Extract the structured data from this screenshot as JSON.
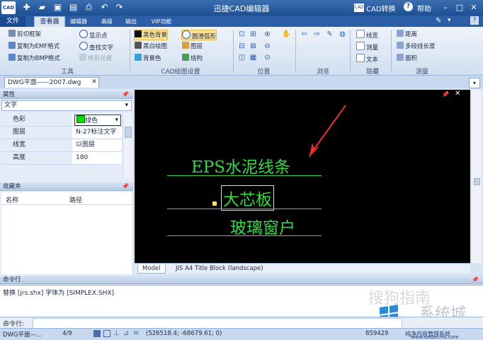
{
  "app": {
    "title": "迅捷CAD编辑器",
    "logo": "CAD",
    "convert_label": "CAD转换",
    "help_label": "帮助"
  },
  "tabs": [
    "文件",
    "查看器",
    "编辑器",
    "高级",
    "输出",
    "VIP功能"
  ],
  "ribbon": {
    "tools": {
      "items": [
        "剪切框架",
        "复制为EMF格式",
        "复制为BMP格式",
        "显示点",
        "查找文字",
        "修剪光栅"
      ],
      "label": "工具"
    },
    "draw": {
      "items": [
        "黑色背景",
        "黑白绘图",
        "背景色",
        "圆滑弧形",
        "图层",
        "结构"
      ],
      "label": "CAD绘图设置"
    },
    "position": {
      "label": "位置"
    },
    "browse": {
      "label": "浏览"
    },
    "hide": {
      "items": [
        "线宽",
        "测量",
        "文本"
      ],
      "label": "隐藏"
    },
    "measure": {
      "items": [
        "距离",
        "多段线长度",
        "面积"
      ],
      "label": "测量"
    }
  },
  "document_tab": "DWG平面——2007.dwg",
  "properties": {
    "title": "属性",
    "dropdown": "文字",
    "rows": [
      {
        "key": "色彩",
        "value": "绿色"
      },
      {
        "key": "图层",
        "value": "N-27标注文字"
      },
      {
        "key": "线宽",
        "value": "以图层"
      },
      {
        "key": "高度",
        "value": "180"
      }
    ],
    "color_swatch": "#00e000"
  },
  "favorites": {
    "title": "收藏夹",
    "columns": [
      "名称",
      "路径"
    ]
  },
  "canvas": {
    "texts": [
      "EPS水泥线条",
      "大芯板",
      "玻璃窗户"
    ],
    "line_color": "#38d846",
    "arrow_color": "#e83030",
    "layout_tabs": [
      "Model",
      "JIS A4 Title Block (landscape)"
    ]
  },
  "command": {
    "title": "命令行",
    "output": "替换 [jrs.shx] 字体为 [SIMPLEX.SHX]",
    "prompt": "命令行:"
  },
  "status": {
    "file": "DWG平面—...",
    "page": "4/9",
    "coords": "(526518.4; -68679.61; 0)",
    "right_value": "859429"
  },
  "watermarks": [
    "搜狗指南",
    "系统城",
    "纯净内容管理系统",
    "www.dedecms.com"
  ]
}
